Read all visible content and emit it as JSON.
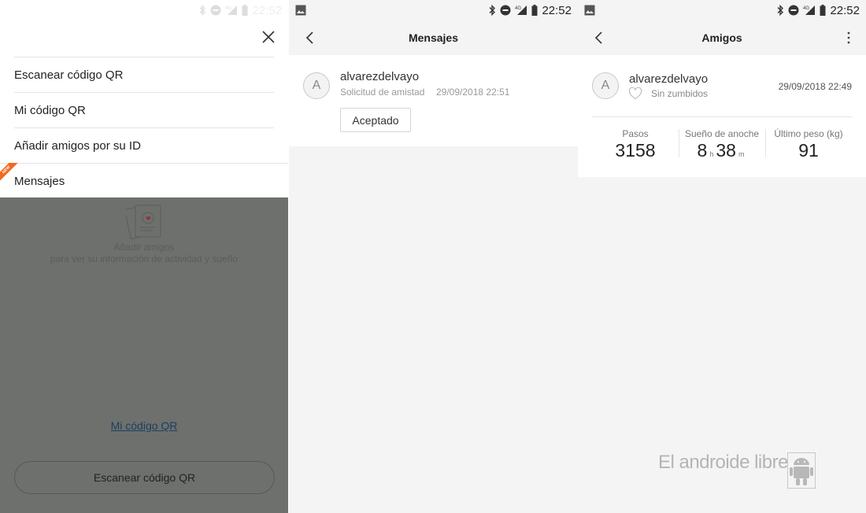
{
  "status": {
    "time": "22:52",
    "network": "4G"
  },
  "panel_menu": {
    "items": [
      {
        "label": "Escanear código QR"
      },
      {
        "label": "Mi código QR"
      },
      {
        "label": "Añadir amigos por su ID"
      },
      {
        "label": "Mensajes",
        "badge": "NEW"
      }
    ],
    "empty_hint_line1": "Añadir amigos",
    "empty_hint_line2": "para ver su información de actividad y sueño",
    "link": "Mi código QR",
    "scan_button": "Escanear código QR"
  },
  "panel_messages": {
    "title": "Mensajes",
    "message": {
      "avatar_letter": "A",
      "username": "alvarezdelvayo",
      "subtitle": "Solicitud de amistad",
      "timestamp": "29/09/2018 22:51",
      "action": "Aceptado"
    }
  },
  "panel_friends": {
    "title": "Amigos",
    "friend": {
      "avatar_letter": "A",
      "username": "alvarezdelvayo",
      "vibration": "Sin zumbidos",
      "timestamp": "29/09/2018 22:49",
      "stats": {
        "steps_label": "Pasos",
        "steps_value": "3158",
        "sleep_label": "Sueño de anoche",
        "sleep_hours": "8",
        "sleep_hours_unit": "h",
        "sleep_minutes": "38",
        "sleep_minutes_unit": "m",
        "weight_label": "Último peso (kg)",
        "weight_value": "91"
      }
    }
  },
  "watermark": "El androide libre",
  "colors": {
    "accent_new": "#f06a22",
    "overlay": "#6e706e"
  }
}
